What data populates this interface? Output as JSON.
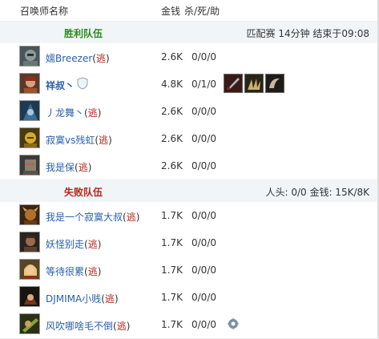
{
  "header": {
    "col_summoner": "召唤师名称",
    "col_gold": "金钱",
    "col_kda": "杀/死/助"
  },
  "win_team": {
    "title": "胜利队伍",
    "match_info": "匹配赛 14分钟 结束于09:08",
    "title_color": "#2a8a1c",
    "players": [
      {
        "name": "嬬Breezer",
        "flee_open": "(",
        "flee": "逃",
        "flee_close": ")",
        "gold": "2.6K",
        "kda": "0/0/0",
        "avatar": "armored-knight-portrait"
      },
      {
        "name": "祥叔丶",
        "gold": "4.8K",
        "kda": "0/1/0",
        "avatar": "gunslinger-portrait",
        "badge": "shield-icon",
        "items": [
          "dagger-item",
          "claw-item",
          "horn-item"
        ]
      },
      {
        "name": "丿龙舞丶",
        "flee_open": "(",
        "flee": "逃",
        "flee_close": ")",
        "gold": "2.6K",
        "kda": "0/0/0",
        "avatar": "hooded-figure-portrait"
      },
      {
        "name": "寂寞vs残虹",
        "flee_open": "(",
        "flee": "逃",
        "flee_close": ")",
        "gold": "2.6K",
        "kda": "0/0/0",
        "avatar": "golden-warrior-portrait"
      },
      {
        "name": "我是保",
        "flee_open": "(",
        "flee": "逃",
        "flee_close": ")",
        "gold": "2.6K",
        "kda": "0/0/0",
        "avatar": "stone-golem-portrait"
      }
    ]
  },
  "lose_team": {
    "title": "失败队伍",
    "summary": "人头: 0/0 金钱: 15K/8K",
    "title_color": "#b8241d",
    "players": [
      {
        "name": "我是一个寂寞大叔",
        "flee_open": "(",
        "flee": "逃",
        "flee_close": ")",
        "gold": "1.7K",
        "kda": "0/0/0",
        "avatar": "beast-warrior-portrait"
      },
      {
        "name": "妖怪别走",
        "flee_open": "(",
        "flee": "逃",
        "flee_close": ")",
        "gold": "1.7K",
        "kda": "0/0/0",
        "avatar": "brawler-portrait"
      },
      {
        "name": "等待很累",
        "flee_open": "(",
        "flee": "逃",
        "flee_close": ")",
        "gold": "1.7K",
        "kda": "0/0/0",
        "avatar": "blonde-hero-portrait"
      },
      {
        "name": "DJMIMA小贱",
        "flee_open": "(",
        "flee": "逃",
        "flee_close": ")",
        "gold": "1.7K",
        "kda": "0/0/0",
        "avatar": "dark-mage-portrait"
      },
      {
        "name": "风吹哪啥毛不倒",
        "flee_open": "(",
        "flee": "逃",
        "flee_close": ")",
        "gold": "1.7K",
        "kda": "0/0/0",
        "avatar": "green-gunner-portrait",
        "badge": "gear-icon"
      }
    ]
  }
}
